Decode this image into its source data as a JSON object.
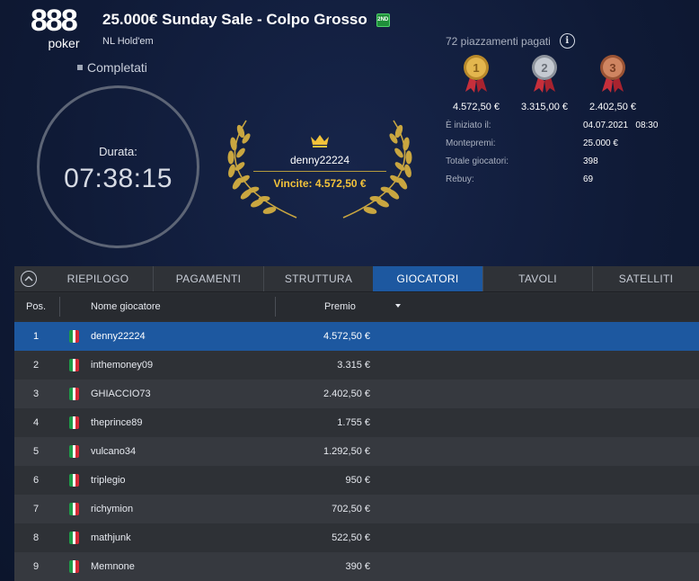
{
  "brand": {
    "logo_top": "888",
    "logo_bottom": "poker"
  },
  "header": {
    "title": "25.000€ Sunday Sale - Colpo Grosso",
    "badge": "2ND",
    "game": "NL Hold'em",
    "status": "Completati"
  },
  "timer": {
    "label": "Durata:",
    "value": "07:38:15"
  },
  "winner": {
    "name": "denny22224",
    "prize": "Vincite: 4.572,50 €"
  },
  "payouts": {
    "paid_places": "72 piazzamenti pagati",
    "medals": [
      {
        "place": "1",
        "amount": "4.572,50 €",
        "color": "#d4a33a"
      },
      {
        "place": "2",
        "amount": "3.315,00 €",
        "color": "#a7acb4"
      },
      {
        "place": "3",
        "amount": "2.402,50 €",
        "color": "#b96a45"
      }
    ]
  },
  "info": [
    {
      "label": "È iniziato il:",
      "value": "04.07.2021   08:30"
    },
    {
      "label": "Montepremi:",
      "value": "25.000 €"
    },
    {
      "label": "Totale giocatori:",
      "value": "398"
    },
    {
      "label": "Rebuy:",
      "value": "69"
    }
  ],
  "tabs": [
    {
      "label": "RIEPILOGO",
      "active": false
    },
    {
      "label": "PAGAMENTI",
      "active": false
    },
    {
      "label": "STRUTTURA",
      "active": false
    },
    {
      "label": "GIOCATORI",
      "active": true
    },
    {
      "label": "TAVOLI",
      "active": false
    },
    {
      "label": "SATELLITI",
      "active": false
    }
  ],
  "table": {
    "columns": {
      "pos": "Pos.",
      "name": "Nome giocatore",
      "prize": "Premio"
    },
    "rows": [
      {
        "pos": "1",
        "flag": "italy-flag-icon",
        "name": "denny22224",
        "prize": "4.572,50 €",
        "selected": true
      },
      {
        "pos": "2",
        "flag": "italy-flag-icon",
        "name": "inthemoney09",
        "prize": "3.315 €",
        "selected": false
      },
      {
        "pos": "3",
        "flag": "italy-flag-icon",
        "name": "GHIACCIO73",
        "prize": "2.402,50 €",
        "selected": false
      },
      {
        "pos": "4",
        "flag": "italy-flag-icon",
        "name": "theprince89",
        "prize": "1.755 €",
        "selected": false
      },
      {
        "pos": "5",
        "flag": "italy-flag-icon",
        "name": "vulcano34",
        "prize": "1.292,50 €",
        "selected": false
      },
      {
        "pos": "6",
        "flag": "italy-flag-icon",
        "name": "triplegio",
        "prize": "950 €",
        "selected": false
      },
      {
        "pos": "7",
        "flag": "italy-flag-icon",
        "name": "richymion",
        "prize": "702,50 €",
        "selected": false
      },
      {
        "pos": "8",
        "flag": "italy-flag-icon",
        "name": "mathjunk",
        "prize": "522,50 €",
        "selected": false
      },
      {
        "pos": "9",
        "flag": "italy-flag-icon",
        "name": "Memnone",
        "prize": "390 €",
        "selected": false
      }
    ]
  },
  "colors": {
    "accent": "#1d58a0",
    "gold": "#f2c23a",
    "background": "#0f1a36"
  }
}
